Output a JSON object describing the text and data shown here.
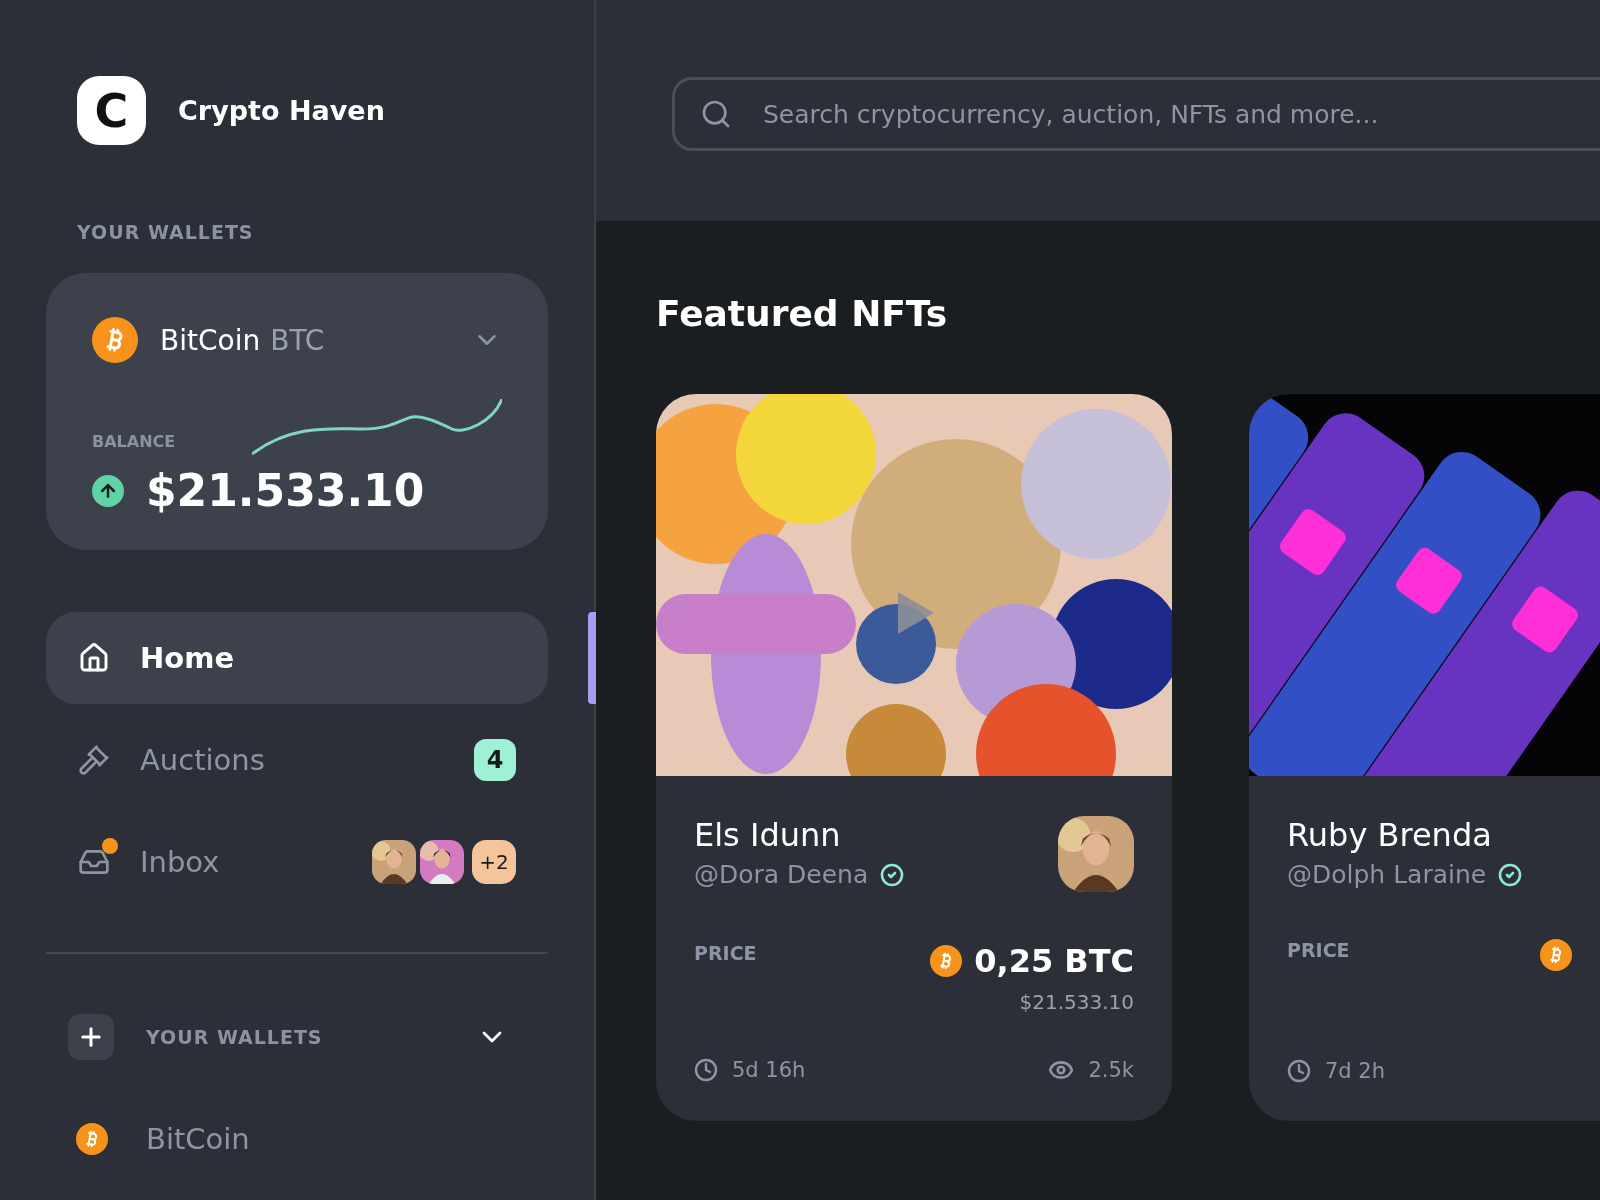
{
  "brand": {
    "logo_letter": "C",
    "name": "Crypto Haven"
  },
  "wallets_heading": "YOUR WALLETS",
  "wallet": {
    "name": "BitCoin",
    "ticker": "BTC",
    "balance_label": "BALANCE",
    "balance": "$21.533.10"
  },
  "nav": [
    {
      "label": "Home",
      "selected": true
    },
    {
      "label": "Auctions",
      "selected": false,
      "badge": "4"
    },
    {
      "label": "Inbox",
      "selected": false,
      "unread": true,
      "more": "+2"
    }
  ],
  "wallets_section": {
    "title": "YOUR WALLETS",
    "expanded": true,
    "items": [
      {
        "name": "BitCoin"
      }
    ]
  },
  "search": {
    "placeholder": "Search cryptocurrency, auction, NFTs and more..."
  },
  "featured": {
    "title": "Featured NFTs",
    "cards": [
      {
        "video": true,
        "title": "Els Idunn",
        "handle": "@Dora Deena",
        "verified": true,
        "price_label": "PRICE",
        "price": "0,25 BTC",
        "price_usd": "$21.533.10",
        "time": "5d 16h",
        "views": "2.5k"
      },
      {
        "video": false,
        "title": "Ruby Brenda",
        "handle": "@Dolph Laraine",
        "verified": true,
        "price_label": "PRICE",
        "time": "7d 2h"
      }
    ]
  }
}
